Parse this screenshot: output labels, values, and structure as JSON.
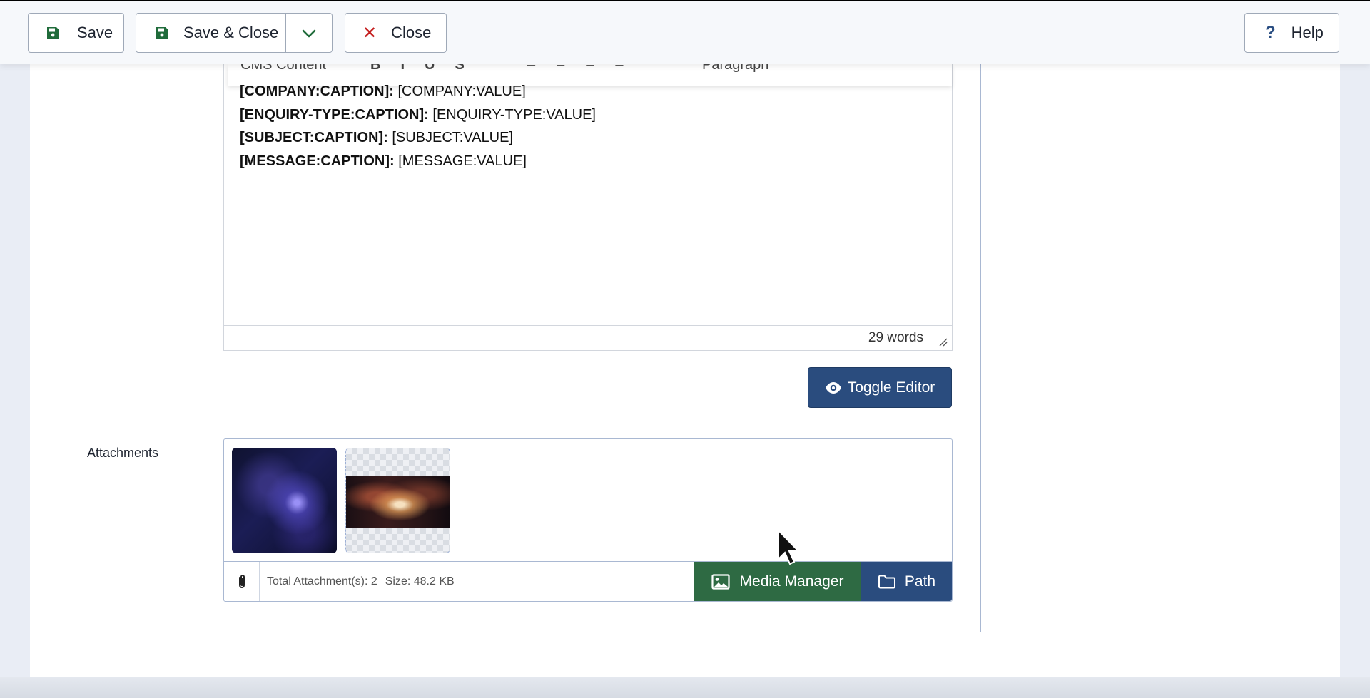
{
  "toolbar": {
    "save_label": "Save",
    "save_close_label": "Save & Close",
    "close_label": "Close",
    "help_label": "Help",
    "help_glyph": "?",
    "close_glyph": "✕"
  },
  "editor": {
    "toolbar_fragments": [
      "CMS Content",
      "Paragraph"
    ],
    "lines": [
      {
        "caption": "[COMPANY:CAPTION]:",
        "value": " [COMPANY:VALUE]"
      },
      {
        "caption": "[ENQUIRY-TYPE:CAPTION]:",
        "value": " [ENQUIRY-TYPE:VALUE]"
      },
      {
        "caption": "[SUBJECT:CAPTION]:",
        "value": " [SUBJECT:VALUE]"
      },
      {
        "caption": "[MESSAGE:CAPTION]:",
        "value": " [MESSAGE:VALUE]"
      }
    ],
    "word_count": "29 words",
    "toggle_label": "Toggle Editor"
  },
  "attachments": {
    "label": "Attachments",
    "total_text": "Total Attachment(s): 2",
    "size_text": "Size: 48.2 KB",
    "media_manager_label": "Media Manager",
    "path_label": "Path"
  },
  "colors": {
    "primary_blue": "#2a4c7e",
    "success_green": "#2e6a43",
    "danger_red": "#c41d1d",
    "icon_green": "#1f6b3a"
  }
}
